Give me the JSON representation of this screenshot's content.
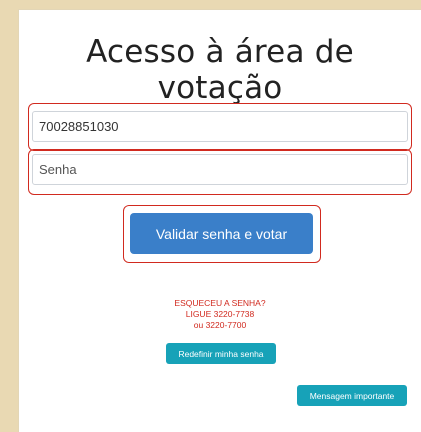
{
  "title": "Acesso à área de votação",
  "login": {
    "user_value": "70028851030",
    "password_placeholder": "Senha"
  },
  "actions": {
    "submit_label": "Validar senha e votar"
  },
  "forgot": {
    "line1": "ESQUECEU A SENHA?",
    "line2": "LIGUE 3220-7738",
    "line3": "ou 3220-7700"
  },
  "links": {
    "reset_password_label": "Redefinir minha senha",
    "important_message_label": "Mensagem importante"
  },
  "colors": {
    "background": "#e9d9b3",
    "highlight": "#d12a1f",
    "primary": "#3a7fc9",
    "teal": "#17a2b8"
  }
}
